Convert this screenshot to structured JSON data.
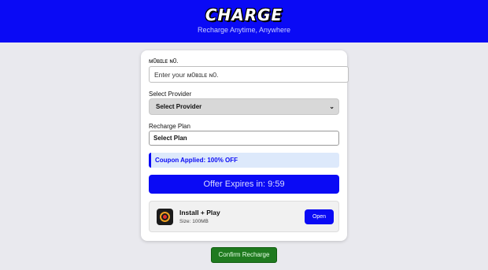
{
  "header": {
    "logo": "CHARGE",
    "tagline": "Recharge Anytime, Anywhere"
  },
  "form": {
    "mobile_label": "ᴍ0ʙɪʟᴇ ɴ0.",
    "mobile_placeholder": "Enter your ᴍ0ʙɪʟᴇ ɴ0.",
    "provider_label": "Select Provider",
    "provider_selected": "Select Provider",
    "plan_label": "Recharge Plan",
    "plan_value": "Select Plan",
    "coupon_text": "Coupon Applied: 100% OFF",
    "offer_text": "Offer Expires in: 9:59"
  },
  "app_promo": {
    "name": "Install + Play",
    "size": "Size: 100MB",
    "open_label": "Open"
  },
  "confirm_label": "Confirm Recharge",
  "colors": {
    "brand_blue": "#0a0af5",
    "confirm_green": "#1f7a1f",
    "coupon_bg": "#dde9fb"
  }
}
